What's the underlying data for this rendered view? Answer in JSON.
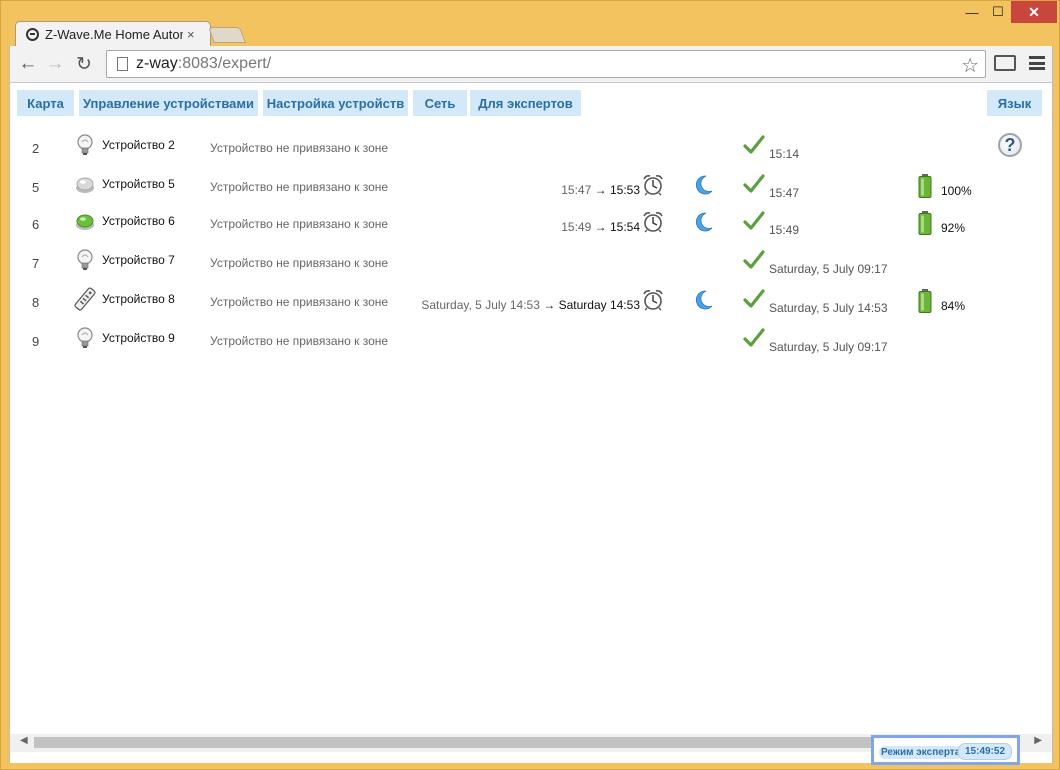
{
  "browser": {
    "tab_title": "Z-Wave.Me Home Autom",
    "tab_close": "×",
    "url_host": "z-way",
    "url_rest": ":8083/expert/"
  },
  "window_controls": {
    "minimize": "—",
    "maximize": "☐",
    "close": "✕"
  },
  "nav": {
    "back": "←",
    "forward": "→",
    "reload": "↻",
    "star": "☆"
  },
  "menu": {
    "map": "Карта",
    "device_management": "Управление устройствами",
    "device_setup": "Настройка устройств",
    "network": "Сеть",
    "for_experts": "Для экспертов",
    "language": "Язык"
  },
  "help": "?",
  "devices": [
    {
      "id": "2",
      "icon": "bulb-icon",
      "name": "Устройство 2",
      "zone": "Устройство не привязано к зоне",
      "wake_last": "",
      "wake_arrow": "",
      "wake_next": "",
      "alarm": false,
      "sleeping": false,
      "status_ok": true,
      "last_update": "15:14",
      "battery": ""
    },
    {
      "id": "5",
      "icon": "button-gray-icon",
      "name": "Устройство 5",
      "zone": "Устройство не привязано к зоне",
      "wake_last": "15:47",
      "wake_arrow": "→",
      "wake_next": "15:53",
      "alarm": true,
      "sleeping": true,
      "status_ok": true,
      "last_update": "15:47",
      "battery": "100%"
    },
    {
      "id": "6",
      "icon": "button-green-icon",
      "name": "Устройство 6",
      "zone": "Устройство не привязано к зоне",
      "wake_last": "15:49",
      "wake_arrow": "→",
      "wake_next": "15:54",
      "alarm": true,
      "sleeping": true,
      "status_ok": true,
      "last_update": "15:49",
      "battery": "92%"
    },
    {
      "id": "7",
      "icon": "bulb-icon",
      "name": "Устройство 7",
      "zone": "Устройство не привязано к зоне",
      "wake_last": "",
      "wake_arrow": "",
      "wake_next": "",
      "alarm": false,
      "sleeping": false,
      "status_ok": true,
      "last_update": "Saturday, 5 July 09:17",
      "battery": ""
    },
    {
      "id": "8",
      "icon": "remote-icon",
      "name": "Устройство 8",
      "zone": "Устройство не привязано к зоне",
      "wake_last": "Saturday, 5 July 14:53",
      "wake_arrow": "→",
      "wake_next": "Saturday 14:53",
      "alarm": true,
      "sleeping": true,
      "status_ok": true,
      "last_update": "Saturday, 5 July 14:53",
      "battery": "84%"
    },
    {
      "id": "9",
      "icon": "bulb-icon",
      "name": "Устройство 9",
      "zone": "Устройство не привязано к зоне",
      "wake_last": "",
      "wake_arrow": "",
      "wake_next": "",
      "alarm": false,
      "sleeping": false,
      "status_ok": true,
      "last_update": "Saturday, 5 July 09:17",
      "battery": ""
    }
  ],
  "footer": {
    "expert_mode": "Режим эксперта",
    "clock": "15:49:52"
  },
  "colors": {
    "menu_bg": "#d3e8f8",
    "menu_text": "#2a6fa5",
    "check": "#5aa03c",
    "battery": "#6cb43a"
  }
}
